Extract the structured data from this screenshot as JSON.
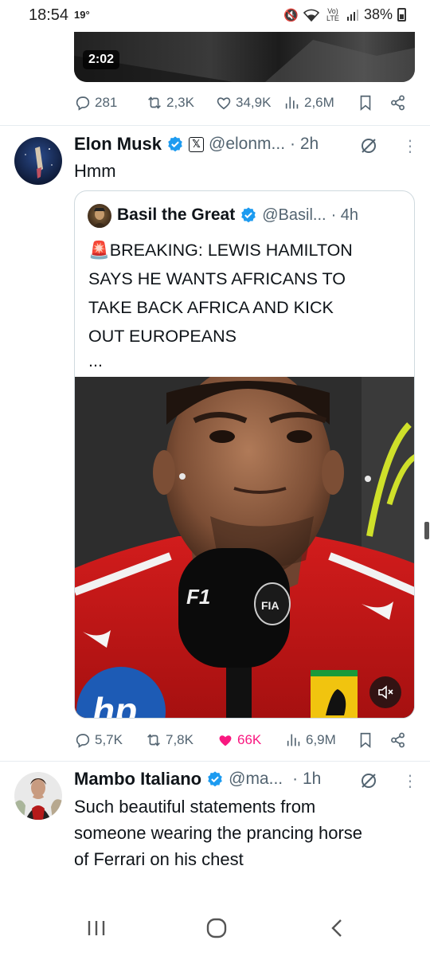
{
  "status_bar": {
    "time": "18:54",
    "temperature": "19°",
    "network": "Vo) LTE",
    "battery": "38%"
  },
  "top_tweet": {
    "video_duration": "2:02",
    "replies": "281",
    "reposts": "2,3K",
    "likes": "34,9K",
    "views": "2,6M"
  },
  "tweet": {
    "author_name": "Elon Musk",
    "handle": "@elonm...",
    "time": "· 2h",
    "text": "Hmm",
    "replies": "5,7K",
    "reposts": "7,8K",
    "likes": "66K",
    "views": "6,9M",
    "quote": {
      "author_name": "Basil the Great",
      "handle": "@Basil...",
      "time": "· 4h",
      "emoji": "🚨",
      "line1": "BREAKING: LEWIS HAMILTON",
      "line2": "SAYS HE WANTS AFRICANS TO",
      "line3": "TAKE BACK AFRICA AND KICK",
      "line4": "OUT EUROPEANS",
      "ellipsis": "...",
      "mic_brand_1": "F1",
      "mic_brand_2": "FIA",
      "shirt_brand": "hp"
    }
  },
  "reply_tweet": {
    "author_name": "Mambo Italiano",
    "handle": "@ma...",
    "time": "· 1h",
    "line1": "Such beautiful statements from",
    "line2": "someone wearing the prancing horse",
    "line3": "of Ferrari on his chest"
  },
  "colors": {
    "verified": "#1d9bf0",
    "like_active": "#f91880",
    "secondary_text": "#536471"
  },
  "icons": {
    "reply": "comment-icon",
    "repost": "repost-icon",
    "like": "heart-icon",
    "views": "views-icon",
    "bookmark": "bookmark-icon",
    "share": "share-icon",
    "grok": "grok-icon",
    "more": "more-vertical-icon"
  }
}
